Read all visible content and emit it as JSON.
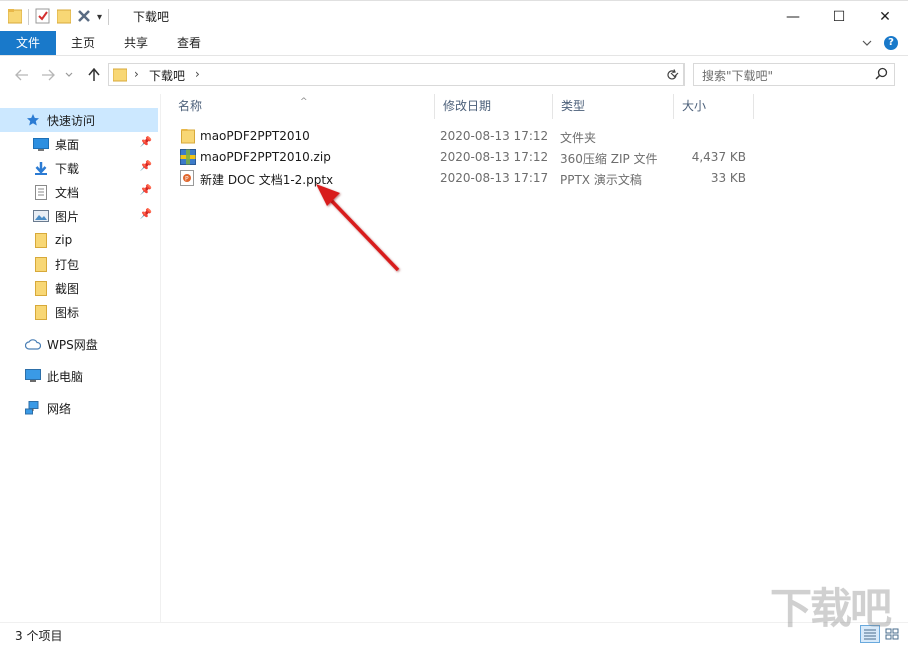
{
  "window": {
    "title": "下载吧",
    "controls": {
      "minimize": "—",
      "maximize": "☐",
      "close": "✕"
    }
  },
  "ribbon": {
    "tabs": [
      "文件",
      "主页",
      "共享",
      "查看"
    ],
    "expand_icon": "chevron-down-icon",
    "help_label": "?"
  },
  "navigation": {
    "path": [
      "下载吧"
    ],
    "search_placeholder": "搜索\"下载吧\""
  },
  "sidebar": {
    "quick_access": "快速访问",
    "items": [
      {
        "label": "桌面",
        "icon": "desktop-icon",
        "pinned": true
      },
      {
        "label": "下载",
        "icon": "download-icon",
        "pinned": true
      },
      {
        "label": "文档",
        "icon": "documents-icon",
        "pinned": true
      },
      {
        "label": "图片",
        "icon": "pictures-icon",
        "pinned": true
      },
      {
        "label": "zip",
        "icon": "folder-icon",
        "pinned": false
      },
      {
        "label": "打包",
        "icon": "folder-icon",
        "pinned": false
      },
      {
        "label": "截图",
        "icon": "folder-icon",
        "pinned": false
      },
      {
        "label": "图标",
        "icon": "folder-icon",
        "pinned": false
      }
    ],
    "roots": [
      {
        "label": "WPS网盘",
        "icon": "cloud-icon"
      },
      {
        "label": "此电脑",
        "icon": "computer-icon"
      },
      {
        "label": "网络",
        "icon": "network-icon"
      }
    ]
  },
  "file_list": {
    "columns": [
      "名称",
      "修改日期",
      "类型",
      "大小"
    ],
    "rows": [
      {
        "name": "maoPDF2PPT2010",
        "modified": "2020-08-13 17:12",
        "type": "文件夹",
        "size": "",
        "icon": "folder-icon"
      },
      {
        "name": "maoPDF2PPT2010.zip",
        "modified": "2020-08-13 17:12",
        "type": "360压缩 ZIP 文件",
        "size": "4,437 KB",
        "icon": "zip-archive-icon"
      },
      {
        "name": "新建 DOC 文档1-2.pptx",
        "modified": "2020-08-13 17:17",
        "type": "PPTX 演示文稿",
        "size": "33 KB",
        "icon": "pptx-file-icon"
      }
    ]
  },
  "status": {
    "item_count": "3 个项目"
  },
  "colors": {
    "accent": "#1979ca",
    "selection": "#cce8ff",
    "folder": "#f8d775",
    "annotation_arrow": "#d81e1e"
  },
  "watermark": "下载吧"
}
